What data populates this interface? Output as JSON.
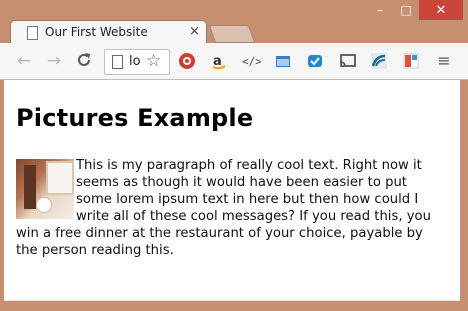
{
  "window": {
    "controls": [
      "–",
      "□",
      "✕"
    ]
  },
  "tab": {
    "title": "Our First Website",
    "close": "×"
  },
  "toolbar": {
    "back": "←",
    "forward": "→",
    "reload": "C",
    "omnibox_text": "lo",
    "star": "☆",
    "menu": "≡",
    "extensions": [
      "settings-icon",
      "amazon-icon",
      "code-icon",
      "folder-icon",
      "tag-icon",
      "cast-icon",
      "wave-icon",
      "bookmark-icon"
    ]
  },
  "page": {
    "heading": "Pictures Example",
    "paragraph": "This is my paragraph of really cool text. Right now it seems as though it would have been easier to put some lorem ipsum text in here but then how could I write all of these cool messages? If you read this, you win a free dinner at the restaurant of your choice, payable by the person reading this."
  },
  "colors": {
    "frame": "#c58f70",
    "close_button": "#c9463d"
  }
}
